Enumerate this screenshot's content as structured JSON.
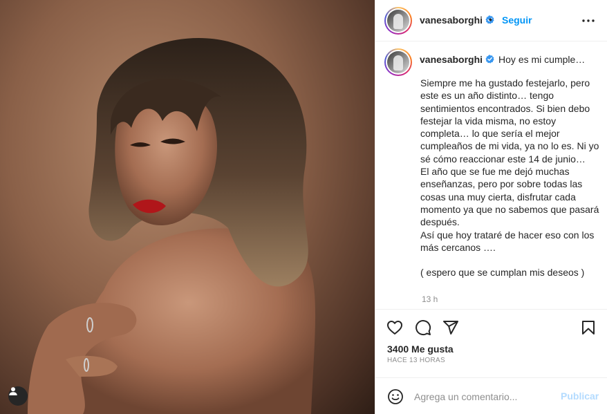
{
  "post": {
    "username": "vanesaborghi",
    "separator": "•",
    "follow_label": "Seguir",
    "caption": {
      "title": "Hoy es mi cumple…",
      "body": "Siempre me ha gustado festejarlo, pero este es un año distinto… tengo sentimientos encontrados. Si bien debo festejar la vida misma, no estoy completa… lo que sería el mejor cumpleaños de mi vida, ya no lo es. Ni yo sé cómo reaccionar este 14 de junio…\nEl año que se fue me dejó muchas enseñanzas, pero por sobre todas las cosas una muy cierta, disfrutar cada momento ya que no sabemos que pasará después.\nAsí que hoy trataré de hacer eso con los más cercanos ….\n\n( espero que se cumplan mis deseos )",
      "time": "13 h"
    },
    "likes": "3400 Me gusta",
    "posted_ago": "HACE 13 HORAS",
    "comment": {
      "placeholder": "Agrega un comentario...",
      "publish_label": "Publicar"
    }
  },
  "icons": {
    "verified": "verified-badge-icon",
    "more": "more-options-icon",
    "like": "heart-icon",
    "comment": "comment-bubble-icon",
    "share": "paper-plane-icon",
    "save": "bookmark-icon",
    "emoji": "emoji-smiley-icon",
    "tags": "user-tag-icon"
  },
  "colors": {
    "link_blue": "#0095f6",
    "publish_disabled": "#b3dbff",
    "verified_blue": "#3897f0",
    "text_primary": "#262626",
    "text_secondary": "#8e8e8e"
  }
}
